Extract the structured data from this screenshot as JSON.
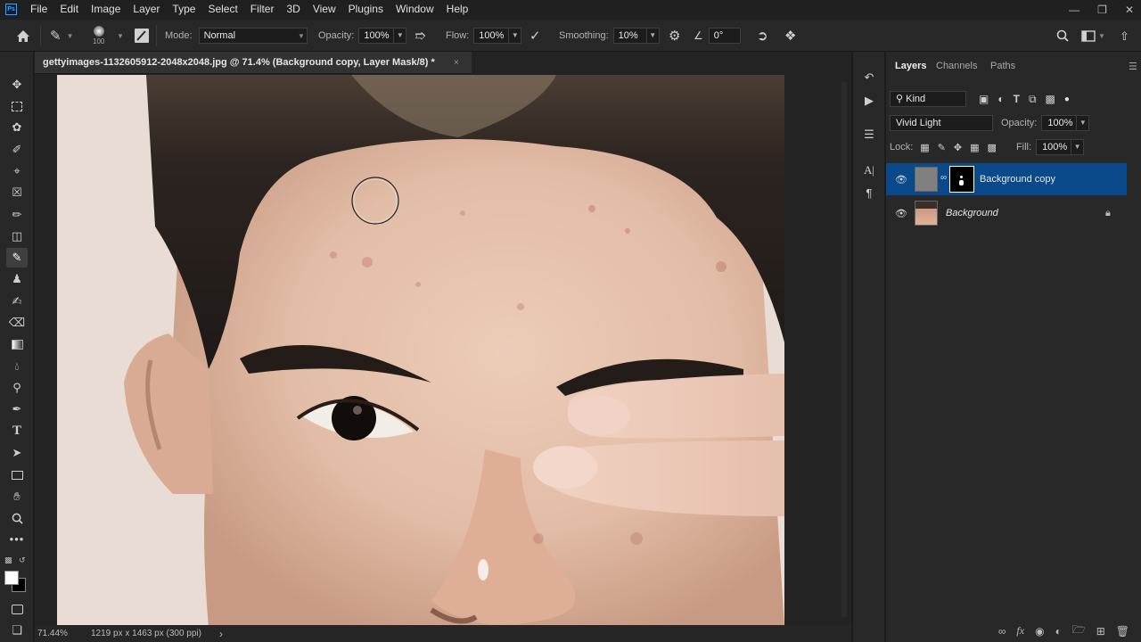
{
  "app": {
    "logo_text": "Ps"
  },
  "menu": [
    "File",
    "Edit",
    "Image",
    "Layer",
    "Type",
    "Select",
    "Filter",
    "3D",
    "View",
    "Plugins",
    "Window",
    "Help"
  ],
  "options_bar": {
    "brush_size": "100",
    "mode_label": "Mode:",
    "mode_value": "Normal",
    "opacity_label": "Opacity:",
    "opacity_value": "100%",
    "flow_label": "Flow:",
    "flow_value": "100%",
    "smoothing_label": "Smoothing:",
    "smoothing_value": "10%",
    "angle_value": "0°"
  },
  "document": {
    "tab_title": "gettyimages-1132605912-2048x2048.jpg @ 71.4% (Background copy, Layer Mask/8) *",
    "close_glyph": "×"
  },
  "status": {
    "zoom": "71.44%",
    "doc_info": "1219 px x 1463 px (300 ppi)",
    "arrow": "›"
  },
  "panel": {
    "tabs": [
      "Layers",
      "Channels",
      "Paths"
    ],
    "filter_kind": "Kind",
    "blend_mode": "Vivid Light",
    "opacity_label": "Opacity:",
    "opacity_value": "100%",
    "lock_label": "Lock:",
    "fill_label": "Fill:",
    "fill_value": "100%",
    "layers": [
      {
        "name": "Background copy",
        "selected": true,
        "has_mask": true
      },
      {
        "name": "Background",
        "selected": false,
        "locked": true
      }
    ]
  },
  "colors": {
    "selection": "#0b4a8a",
    "accent": "#31a8ff"
  }
}
